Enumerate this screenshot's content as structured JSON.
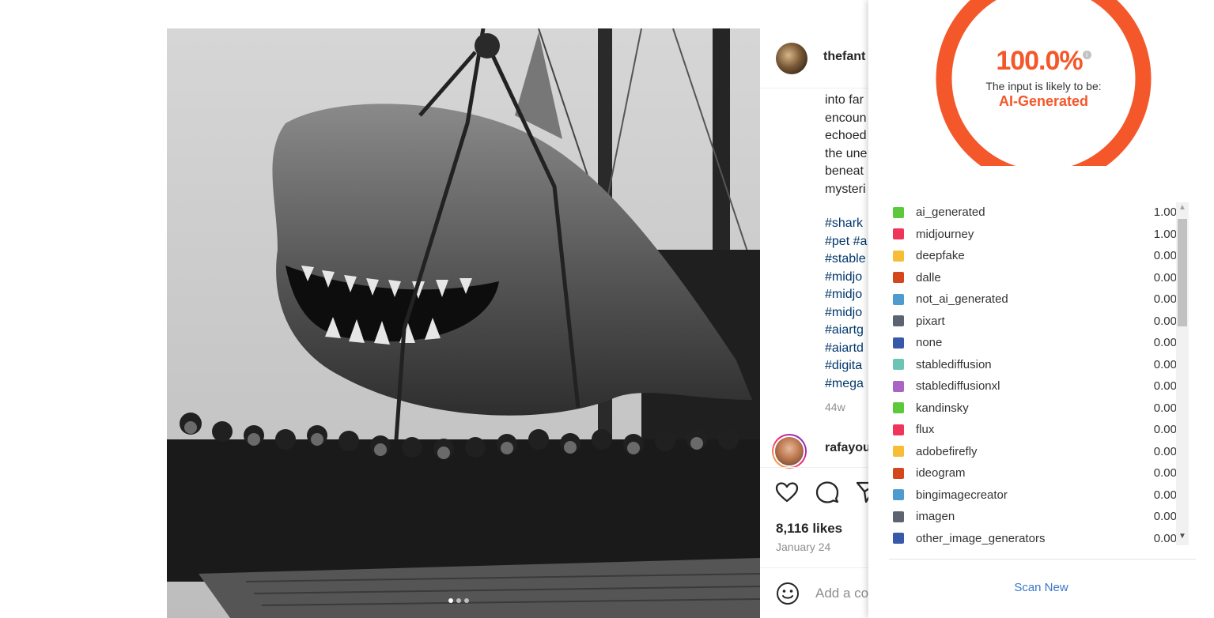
{
  "post": {
    "username": "thefant",
    "caption_lines": [
      "into far",
      "encoun",
      "echoed",
      "the une",
      "beneat",
      "mysteri"
    ],
    "hashtags": [
      "#shark",
      "#pet #a",
      "#stable",
      "#midjo",
      "#midjo",
      "#midjo",
      "#aiartg",
      "#aiartd",
      "#digita",
      "#mega"
    ],
    "time_ago": "44w",
    "comment_user": "rafayou",
    "likes": "8,116 likes",
    "date": "January 24",
    "comment_placeholder": "Add a co"
  },
  "detector": {
    "score": "100.0%",
    "likely_label": "The input is likely to be:",
    "verdict": "AI-Generated",
    "gauge_fraction": 1.0,
    "accent_color": "#f4572a",
    "results": [
      {
        "name": "ai_generated",
        "value": "1.00",
        "color": "#5cc83b"
      },
      {
        "name": "midjourney",
        "value": "1.00",
        "color": "#f0355a"
      },
      {
        "name": "deepfake",
        "value": "0.00",
        "color": "#f8bd37"
      },
      {
        "name": "dalle",
        "value": "0.00",
        "color": "#d4471c"
      },
      {
        "name": "not_ai_generated",
        "value": "0.00",
        "color": "#4e9bd0"
      },
      {
        "name": "pixart",
        "value": "0.00",
        "color": "#5b6470"
      },
      {
        "name": "none",
        "value": "0.00",
        "color": "#3659a8"
      },
      {
        "name": "stablediffusion",
        "value": "0.00",
        "color": "#6cc5b4"
      },
      {
        "name": "stablediffusionxl",
        "value": "0.00",
        "color": "#a865c6"
      },
      {
        "name": "kandinsky",
        "value": "0.00",
        "color": "#5cc83b"
      },
      {
        "name": "flux",
        "value": "0.00",
        "color": "#f0355a"
      },
      {
        "name": "adobefirefly",
        "value": "0.00",
        "color": "#f8bd37"
      },
      {
        "name": "ideogram",
        "value": "0.00",
        "color": "#d4471c"
      },
      {
        "name": "bingimagecreator",
        "value": "0.00",
        "color": "#4e9bd0"
      },
      {
        "name": "imagen",
        "value": "0.00",
        "color": "#5b6470"
      },
      {
        "name": "other_image_generators",
        "value": "0.00",
        "color": "#3659a8"
      }
    ],
    "scan_new": "Scan New"
  },
  "icons": {
    "like": "heart-icon",
    "comment": "comment-icon",
    "share": "share-icon",
    "emoji": "emoji-icon",
    "next": "chevron-right-icon",
    "info": "info-icon"
  }
}
